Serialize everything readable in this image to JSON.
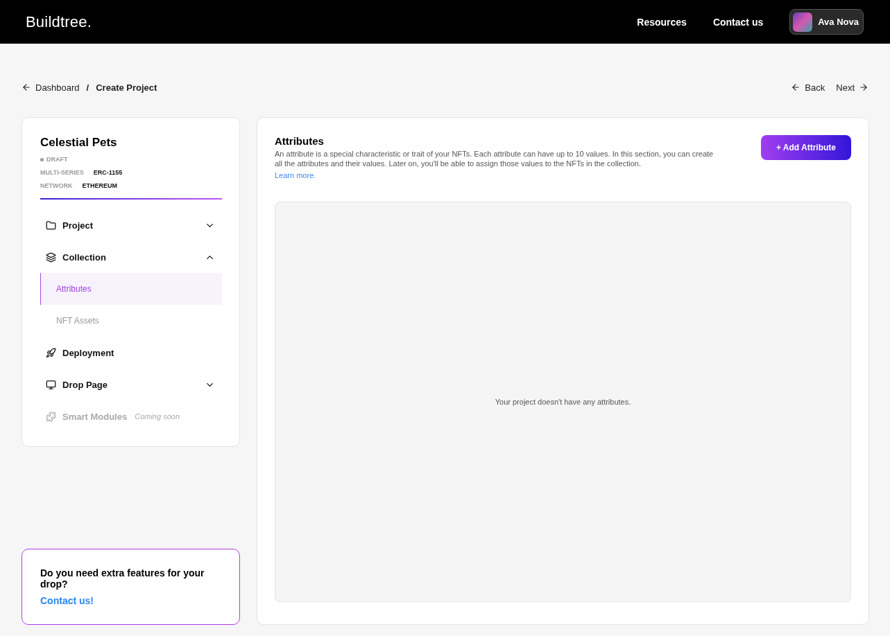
{
  "header": {
    "logo": "Buildtree.",
    "links": [
      "Resources",
      "Contact us"
    ],
    "user": {
      "name": "Ava Nova"
    }
  },
  "breadcrumb": {
    "back": "Dashboard",
    "separator": "/",
    "current": "Create Project"
  },
  "pager": {
    "back": "Back",
    "next": "Next"
  },
  "project": {
    "name": "Celestial Pets",
    "status": "DRAFT",
    "meta": [
      {
        "label": "MULTI-SERIES",
        "value": "ERC-1155"
      },
      {
        "label": "NETWORK",
        "value": "ETHEREUM"
      }
    ]
  },
  "nav": [
    {
      "label": "Project",
      "expanded": false,
      "disabled": false
    },
    {
      "label": "Collection",
      "expanded": true,
      "disabled": false,
      "children": [
        {
          "label": "Attributes",
          "selected": true
        },
        {
          "label": "NFT Assets",
          "selected": false
        }
      ]
    },
    {
      "label": "Deployment",
      "disabled": false
    },
    {
      "label": "Drop Page",
      "expanded": false,
      "disabled": false
    },
    {
      "label": "Smart Modules",
      "disabled": true,
      "note": "Coming soon"
    }
  ],
  "promo": {
    "text": "Do you need extra features for your drop?",
    "link": "Contact us!"
  },
  "main": {
    "title": "Attributes",
    "description": "An attribute is a special characteristic or trait of your NFTs. Each attribute can have up to 10 values. In this section, you can create all the attributes and their values. Later on, you'll be able to assign those values to the NFTs in the collection.",
    "learn_more": "Learn more.",
    "add_button": "+ Add Attribute",
    "empty_text": "Your project doesn't have any attributes."
  }
}
